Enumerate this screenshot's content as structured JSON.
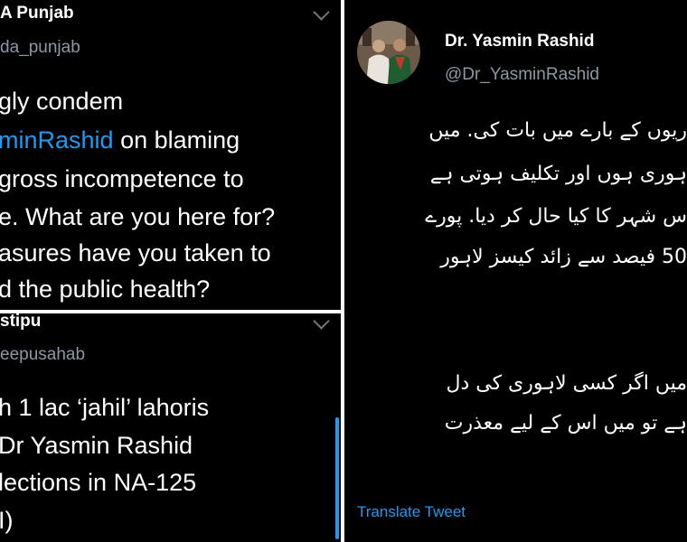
{
  "tweet1": {
    "display_name": "A Punjab",
    "handle": "da_punjab",
    "text": {
      "line1": "gly condem",
      "line2_mention": "minRashid",
      "line2_rest": " on blaming",
      "line3": "gross incompetence to",
      "line4": "e. What are you here for?",
      "line5": "asures have you taken to",
      "line6": "d the public health?"
    }
  },
  "tweet2": {
    "display_name": "stipu",
    "handle": "eepusahab",
    "text": {
      "line1": "h 1 lac ‘jahil’ lahoris",
      "line2": "Dr Yasmin Rashid",
      "line3": "lections in NA-125",
      "line4": "I)"
    }
  },
  "tweet3": {
    "display_name": "Dr. Yasmin Rashid",
    "handle": "@Dr_YasminRashid",
    "urdu_lines": [
      "ریوں کے بارے میں بات کی. میں",
      "ہوری ہوں اور تکلیف ہوتی ہے",
      "س شہر کا کیا حال کر دیا. پورے",
      "50 فیصد سے زائد کیسز لاہور",
      "میں اگر کسی لاہوری کی دل",
      "ہے تو میں اس کے لیے معذرت"
    ],
    "translate_label": "Translate Tweet"
  },
  "colors": {
    "panel_bg": "#000000",
    "link_blue": "#1d9bf0",
    "handle_gray": "#8b98a5"
  }
}
